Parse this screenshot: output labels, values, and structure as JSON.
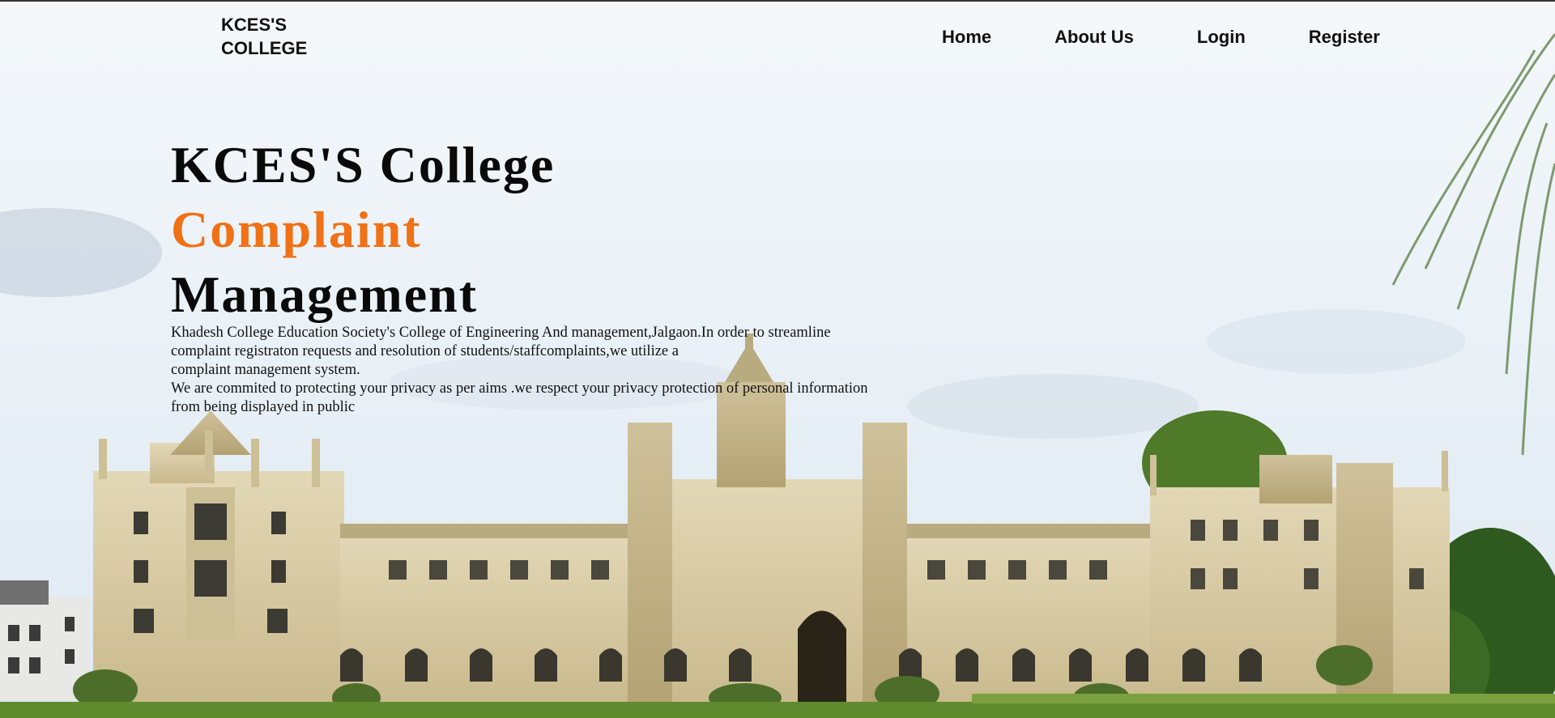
{
  "brand": {
    "line1": "KCES'S",
    "line2": "COLLEGE"
  },
  "nav": {
    "home": "Home",
    "about": "About Us",
    "login": "Login",
    "register": "Register"
  },
  "hero": {
    "title_line1": "KCES'S College",
    "title_line2": "Complaint",
    "title_line3": "Management",
    "desc_lines": [
      "Khadesh College Education Society's College of Engineering And management,Jalgaon.In order to streamline",
      "complaint registraton requests and resolution of students/staffcomplaints,we utilize a",
      "complaint management system.",
      "We are commited to protecting your privacy as per aims .we respect your privacy protection of personal information",
      "from being displayed in public"
    ]
  },
  "colors": {
    "accent": "#f07116",
    "text": "#0a0a0a",
    "sky": "#e9f0f6",
    "stone": "#d8cba4",
    "lawn": "#5f8a2e"
  }
}
